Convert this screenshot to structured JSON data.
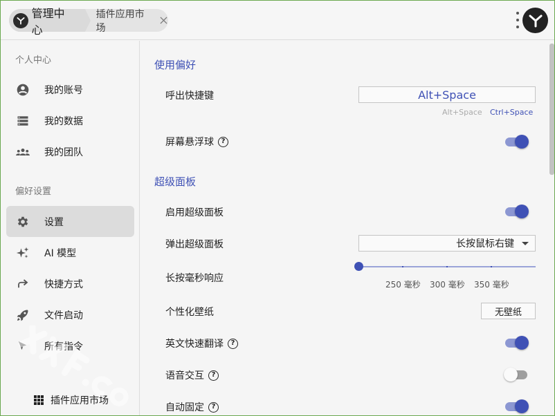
{
  "header": {
    "home_label": "管理中心",
    "tab_label": "插件应用市场"
  },
  "sidebar": {
    "section_personal": "个人中心",
    "section_prefs": "偏好设置",
    "items": [
      {
        "label": "我的账号",
        "icon": "account-circle-icon"
      },
      {
        "label": "我的数据",
        "icon": "storage-list-icon"
      },
      {
        "label": "我的团队",
        "icon": "group-icon"
      },
      {
        "label": "设置",
        "icon": "gear-icon",
        "active": true
      },
      {
        "label": "AI 模型",
        "icon": "sparkle-icon"
      },
      {
        "label": "快捷方式",
        "icon": "share-arrow-icon"
      },
      {
        "label": "文件启动",
        "icon": "rocket-icon"
      },
      {
        "label": "所有指令",
        "icon": "cursor-icon"
      }
    ],
    "bottom_item": "插件应用市场"
  },
  "main": {
    "group_prefs": "使用偏好",
    "hotkey_label": "呼出快捷键",
    "hotkey_value": "Alt+Space",
    "hotkey_opt_a": "Alt+Space",
    "hotkey_opt_b": "Ctrl+Space",
    "float_ball_label": "屏幕悬浮球",
    "group_super": "超级面板",
    "enable_super_label": "启用超级面板",
    "popup_super_label": "弹出超级面板",
    "popup_super_value": "长按鼠标右键",
    "long_press_label": "长按毫秒响应",
    "slider_marks": [
      "250 毫秒",
      "300 毫秒",
      "350 毫秒"
    ],
    "wallpaper_label": "个性化壁纸",
    "wallpaper_button": "无壁纸",
    "translate_label": "英文快速翻译",
    "voice_label": "语音交互",
    "autofix_label": "自动固定",
    "help_glyph": "?"
  },
  "toggles": {
    "float_ball": true,
    "enable_super": true,
    "translate": true,
    "voice": false,
    "autofix": true
  },
  "colors": {
    "accent": "#3f51b5",
    "accent_light": "#8c97d2",
    "border_green": "#6aa84f"
  }
}
